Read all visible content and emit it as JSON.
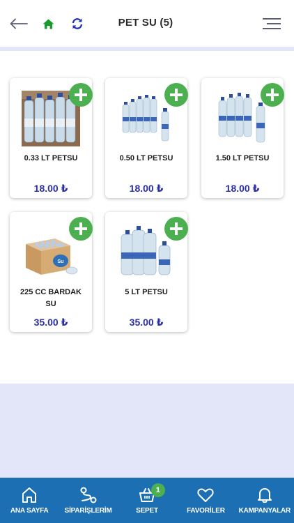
{
  "header": {
    "title": "PET SU (5)",
    "back_icon": "arrow-left-icon",
    "home_icon": "home-icon",
    "refresh_icon": "refresh-icon",
    "menu_icon": "menu-icon"
  },
  "colors": {
    "accent_blue": "#2b2fa6",
    "nav_bg": "#1b6fb2",
    "add_green": "#4caf50",
    "home_green": "#1a9a2c",
    "bg_lavender": "#e3e5f9"
  },
  "products": [
    {
      "name": "0.33 LT PETSU",
      "price": "18.00 ₺",
      "image": "small-bottles-pack-image"
    },
    {
      "name": "0.50 LT PETSU",
      "price": "18.00 ₺",
      "image": "bottle-pack-image"
    },
    {
      "name": "1.50 LT PETSU",
      "price": "18.00 ₺",
      "image": "large-bottles-image"
    },
    {
      "name": "225 CC BARDAK SU",
      "price": "35.00 ₺",
      "image": "cup-water-box-image"
    },
    {
      "name": "5 LT PETSU",
      "price": "35.00 ₺",
      "image": "big-jugs-image"
    }
  ],
  "nav": {
    "items": [
      {
        "label": "ANA SAYFA",
        "icon": "home-outline-icon"
      },
      {
        "label": "SİPARİŞLERİM",
        "icon": "orders-route-icon"
      },
      {
        "label": "SEPET",
        "icon": "basket-icon",
        "badge": "1"
      },
      {
        "label": "FAVORİLER",
        "icon": "heart-icon"
      },
      {
        "label": "KAMPANYALAR",
        "icon": "bell-icon"
      }
    ]
  }
}
